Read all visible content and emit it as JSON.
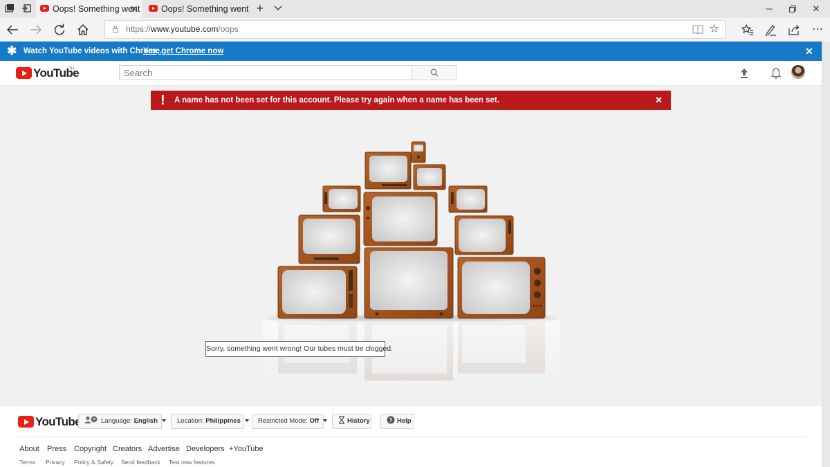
{
  "browser": {
    "tabs": [
      {
        "title": "Oops! Something went"
      },
      {
        "title": "Oops! Something went wro"
      }
    ],
    "url": {
      "scheme": "https://",
      "domain": "www.youtube.com",
      "path": "/oops"
    }
  },
  "promo": {
    "message": "Watch YouTube videos with Chrome.",
    "link": "Yes, get Chrome now"
  },
  "masthead": {
    "logo_text": "YouTube",
    "region": "PH",
    "search_placeholder": "Search"
  },
  "alert": {
    "icon": "!",
    "message": "A name has not been set for this account. Please try again when a name has been set."
  },
  "error_page": {
    "message": "Sorry, something went wrong! Our tubes must be clogged."
  },
  "footer": {
    "logo_text": "YouTube",
    "language": {
      "label": "Language:",
      "value": "English"
    },
    "location": {
      "label": "Location:",
      "value": "Philippines"
    },
    "restricted": {
      "label": "Restricted Mode:",
      "value": "Off"
    },
    "history": "History",
    "help": "Help",
    "links": [
      "About",
      "Press",
      "Copyright",
      "Creators",
      "Advertise",
      "Developers",
      "+YouTube"
    ],
    "small_links": [
      "Terms",
      "Privacy",
      "Policy & Safety",
      "Send feedback",
      "Test new features"
    ]
  },
  "colors": {
    "brand_red": "#e62117",
    "promo_blue": "#167ac6",
    "alert_red": "#b9191b"
  }
}
